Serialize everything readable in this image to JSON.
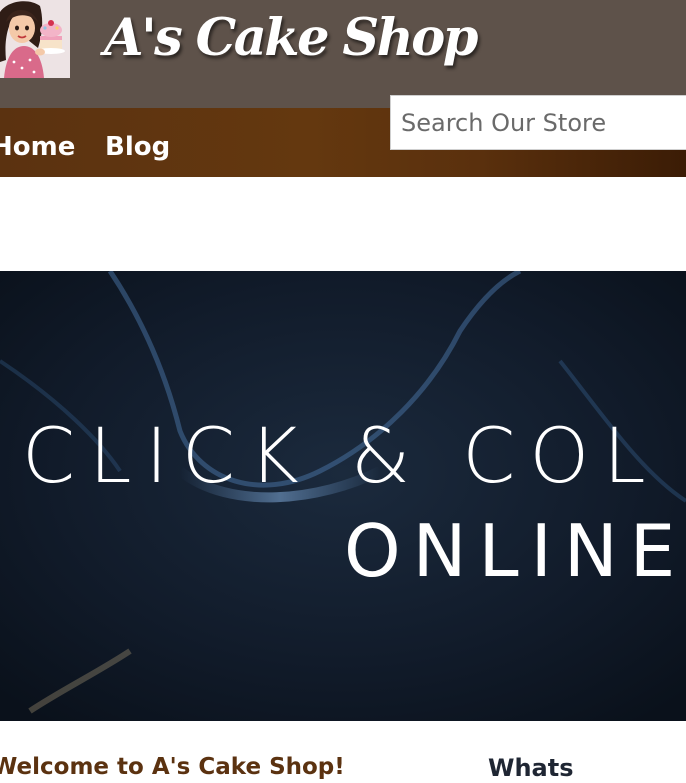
{
  "header": {
    "site_title": "A's Cake Shop",
    "background_color": "#5e524a",
    "logo_icon": "baker-girl-logo-icon"
  },
  "nav": {
    "items": [
      {
        "label": "Home"
      },
      {
        "label": "Blog"
      }
    ],
    "background_color": "#5b3210"
  },
  "search": {
    "placeholder": "Search Our Store",
    "value": ""
  },
  "banner": {
    "line1": "CLICK & COL",
    "line2": "ONLINE",
    "background_color": "#0d1624"
  },
  "main": {
    "welcome_heading": "Welcome to A's Cake Shop!",
    "welcome_color": "#5b3210"
  },
  "sidebar": {
    "heading": "Whats"
  }
}
